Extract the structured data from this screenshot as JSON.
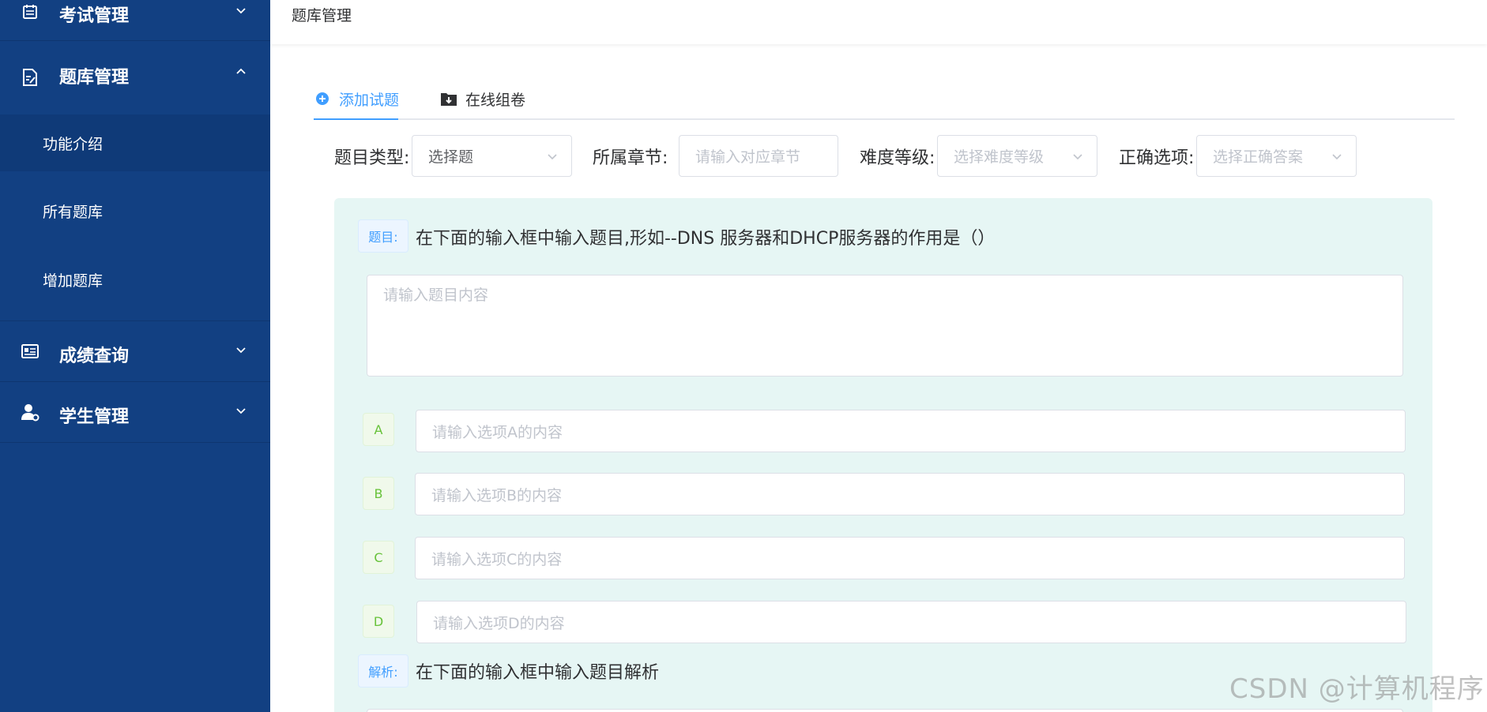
{
  "sidebar": {
    "menus": [
      {
        "label": "考试管理",
        "icon": "calendar-icon",
        "expanded": false
      },
      {
        "label": "题库管理",
        "icon": "edit-doc-icon",
        "expanded": true
      },
      {
        "label": "成绩查询",
        "icon": "id-card-icon",
        "expanded": false
      },
      {
        "label": "学生管理",
        "icon": "user-gear-icon",
        "expanded": false
      }
    ],
    "subitems": [
      {
        "label": "功能介绍",
        "active": true
      },
      {
        "label": "所有题库",
        "active": false
      },
      {
        "label": "增加题库",
        "active": false
      }
    ]
  },
  "header": {
    "breadcrumb": "题库管理"
  },
  "tabs": [
    {
      "label": "添加试题",
      "icon": "plus-circle-icon",
      "active": true
    },
    {
      "label": "在线组卷",
      "icon": "folder-download-icon",
      "active": false
    }
  ],
  "filters": {
    "type": {
      "label": "题目类型:",
      "value": "选择题"
    },
    "chapter": {
      "label": "所属章节:",
      "placeholder": "请输入对应章节"
    },
    "difficulty": {
      "label": "难度等级:",
      "placeholder": "选择难度等级"
    },
    "answer": {
      "label": "正确选项:",
      "placeholder": "选择正确答案"
    }
  },
  "question": {
    "tag": "题目:",
    "hint": "在下面的输入框中输入题目,形如--DNS 服务器和DHCP服务器的作用是（）",
    "placeholder": "请输入题目内容"
  },
  "options": [
    {
      "letter": "A",
      "placeholder": "请输入选项A的内容"
    },
    {
      "letter": "B",
      "placeholder": "请输入选项B的内容"
    },
    {
      "letter": "C",
      "placeholder": "请输入选项C的内容"
    },
    {
      "letter": "D",
      "placeholder": "请输入选项D的内容"
    }
  ],
  "analysis": {
    "tag": "解析:",
    "hint": "在下面的输入框中输入题目解析"
  },
  "watermark": "CSDN @计算机程序",
  "colors": {
    "sidebar_bg": "#124082",
    "accent": "#409eff",
    "panel_bg": "#e6f6f4",
    "option_tag": "#67c23a"
  }
}
